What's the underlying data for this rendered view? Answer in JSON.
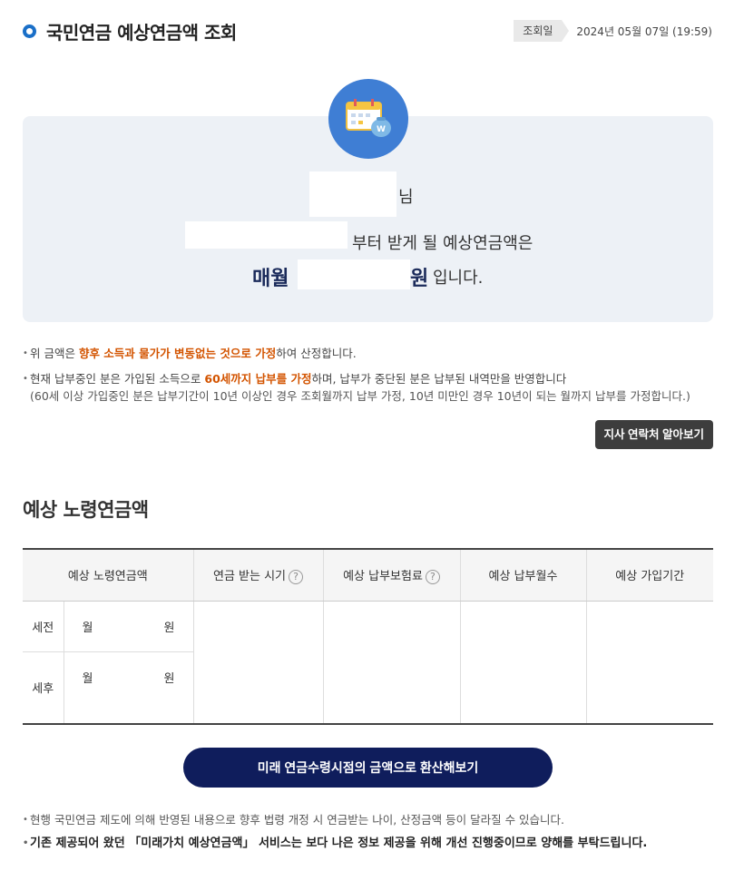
{
  "header": {
    "title": "국민연금 예상연금액 조회",
    "date_label": "조회일",
    "date_value": "2024년 05월 07일 (19:59)"
  },
  "summary": {
    "icon": "calendar-money-icon",
    "name_suffix": "님",
    "line2_suffix": "부터 받게 될 예상연금액은",
    "monthly_prefix": "매월",
    "won": "원",
    "ending": "입니다."
  },
  "notes": {
    "n1_a": "위 금액은 ",
    "n1_hl": "향후 소득과 물가가 변동없는 것으로 가정",
    "n1_b": "하여 산정합니다.",
    "n2_a": "현재 납부중인 분은 가입된 소득으로 ",
    "n2_hl": "60세까지 납부를 가정",
    "n2_b": "하며, 납부가 중단된 분은 납부된 내역만을 반영합니다",
    "n2_sub": "(60세 이상 가입중인 분은 납부기간이 10년 이상인 경우 조회월까지 납부 가정, 10년 미만인 경우 10년이 되는 월까지 납부를 가정합니다.)"
  },
  "branch_button": "지사 연락처 알아보기",
  "section_title": "예상 노령연금액",
  "table": {
    "headers": [
      "예상 노령연금액",
      "연금 받는 시기",
      "예상 납부보험료",
      "예상 납부월수",
      "예상 가입기간"
    ],
    "help_mark": "?",
    "rows": [
      {
        "label": "세전",
        "month": "월",
        "won": "원"
      },
      {
        "label": "세후",
        "month": "월",
        "won": "원"
      }
    ]
  },
  "convert_button": "미래 연금수령시점의 금액으로 환산해보기",
  "footer": {
    "note1": "현행 국민연금 제도에 의해 반영된 내용으로 향후 법령 개정 시 연금받는 나이, 산정금액 등이 달라질 수 있습니다.",
    "note2": "기존 제공되어 왔던 「미래가치 예상연금액」 서비스는 보다 나은 정보 제공을 위해 개선 진행중이므로 양해를 부탁드립니다."
  },
  "colors": {
    "accent": "#1a6fc8",
    "highlight": "#d35400",
    "navy": "#0f1d5c",
    "panel": "#edf1f6"
  }
}
